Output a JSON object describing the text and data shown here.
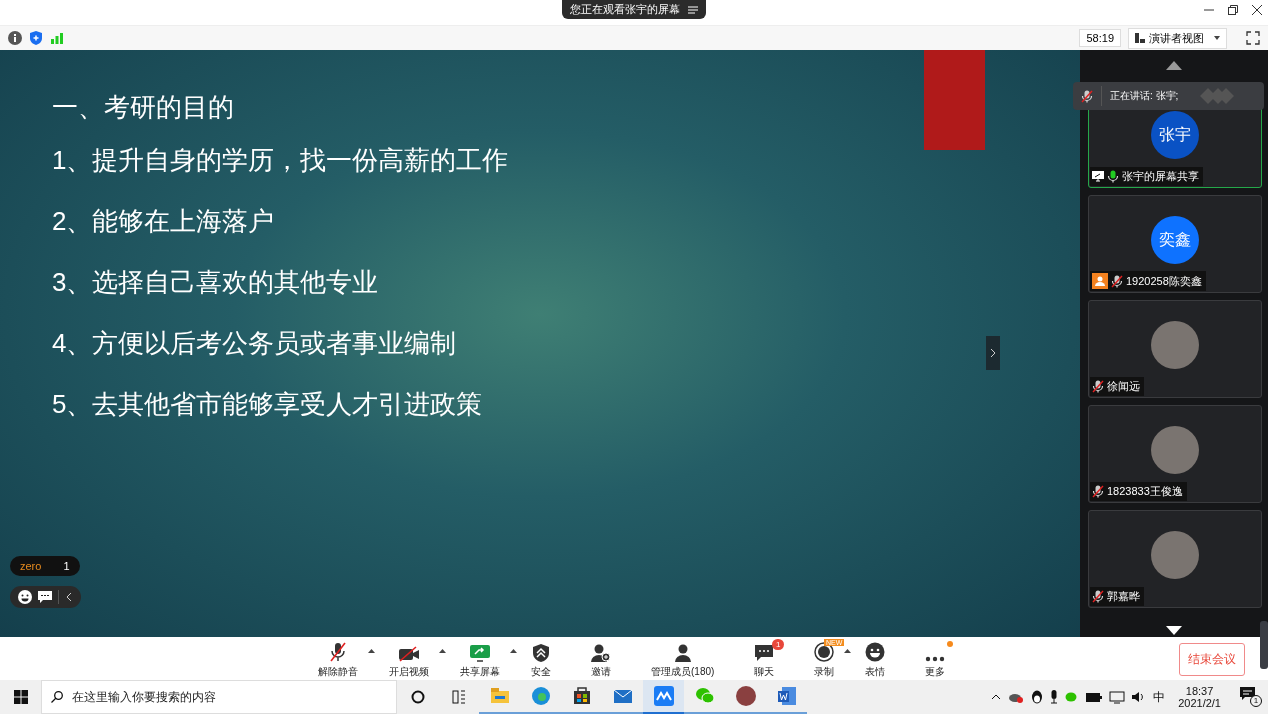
{
  "window": {
    "viewing_banner": "您正在观看张宇的屏幕",
    "timer": "58:19",
    "view_mode": "演讲者视图"
  },
  "slide": {
    "heading": "一、考研的目的",
    "lines": [
      "1、提升自身的学历，找一份高薪的工作",
      "2、能够在上海落户",
      "3、选择自己喜欢的其他专业",
      "4、方便以后考公务员或者事业编制",
      "5、去其他省市能够享受人才引进政策"
    ]
  },
  "overlay": {
    "user_label": "zero",
    "user_count": "1"
  },
  "speaking": {
    "text": "正在讲话: 张宇;"
  },
  "participants": [
    {
      "kind": "screen_share",
      "name": "张宇的屏幕共享",
      "avatar_text": "张宇",
      "color": "#0a52c4",
      "mic_muted": false,
      "selected": true
    },
    {
      "kind": "host",
      "name": "1920258陈奕鑫",
      "avatar_text": "奕鑫",
      "color": "#0e72ff",
      "mic_muted": true,
      "selected": false
    },
    {
      "kind": "attendee",
      "name": "徐闻远",
      "mic_muted": true,
      "selected": false
    },
    {
      "kind": "attendee",
      "name": "1823833王俊逸",
      "mic_muted": true,
      "selected": false
    },
    {
      "kind": "attendee",
      "name": "郭嘉晔",
      "mic_muted": true,
      "selected": false
    }
  ],
  "toolbar": [
    {
      "kind": "mic",
      "label": "解除静音",
      "caret": true
    },
    {
      "kind": "video",
      "label": "开启视频",
      "caret": true
    },
    {
      "kind": "share",
      "label": "共享屏幕",
      "caret": true
    },
    {
      "kind": "security",
      "label": "安全",
      "caret": false
    },
    {
      "kind": "invite",
      "label": "邀请",
      "caret": false
    },
    {
      "kind": "members",
      "label": "管理成员(180)",
      "caret": false
    },
    {
      "kind": "chat",
      "label": "聊天",
      "caret": false,
      "badge": "1"
    },
    {
      "kind": "record",
      "label": "录制",
      "caret": true,
      "ribbon": "NEW"
    },
    {
      "kind": "emoji",
      "label": "表情",
      "caret": false
    },
    {
      "kind": "more",
      "label": "更多",
      "caret": false,
      "dot": true
    }
  ],
  "end_button": "结束会议",
  "taskbar": {
    "search_placeholder": "在这里输入你要搜索的内容",
    "apps": [
      {
        "kind": "explorer",
        "selected": false
      },
      {
        "kind": "edge",
        "selected": false
      },
      {
        "kind": "store",
        "selected": false
      },
      {
        "kind": "mail",
        "selected": false
      },
      {
        "kind": "meeting",
        "selected": true
      },
      {
        "kind": "wechat",
        "selected": false
      },
      {
        "kind": "photo",
        "selected": false
      },
      {
        "kind": "word",
        "selected": false
      }
    ],
    "ime": "中",
    "time": "18:37",
    "date": "2021/2/1",
    "notifications": "1"
  }
}
